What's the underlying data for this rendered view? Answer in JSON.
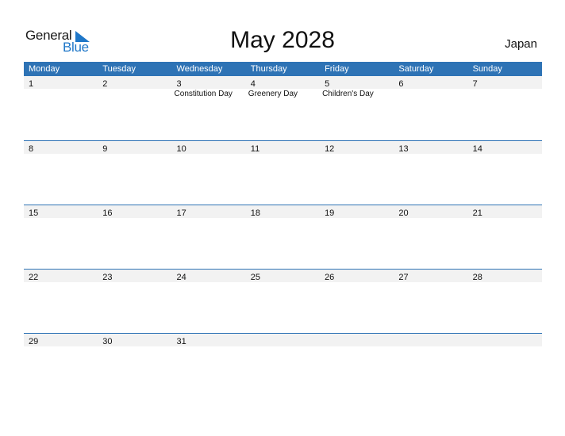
{
  "logo": {
    "word1": "General",
    "word2": "Blue"
  },
  "title": "May 2028",
  "country": "Japan",
  "colors": {
    "accent": "#2e73b5",
    "band": "#f2f2f2",
    "logo_blue": "#1f77c8"
  },
  "weekdays": [
    "Monday",
    "Tuesday",
    "Wednesday",
    "Thursday",
    "Friday",
    "Saturday",
    "Sunday"
  ],
  "weeks": [
    {
      "days": [
        "1",
        "2",
        "3",
        "4",
        "5",
        "6",
        "7"
      ],
      "holidays": [
        "",
        "",
        "Constitution Day",
        "Greenery Day",
        "Children's Day",
        "",
        ""
      ]
    },
    {
      "days": [
        "8",
        "9",
        "10",
        "11",
        "12",
        "13",
        "14"
      ],
      "holidays": [
        "",
        "",
        "",
        "",
        "",
        "",
        ""
      ]
    },
    {
      "days": [
        "15",
        "16",
        "17",
        "18",
        "19",
        "20",
        "21"
      ],
      "holidays": [
        "",
        "",
        "",
        "",
        "",
        "",
        ""
      ]
    },
    {
      "days": [
        "22",
        "23",
        "24",
        "25",
        "26",
        "27",
        "28"
      ],
      "holidays": [
        "",
        "",
        "",
        "",
        "",
        "",
        ""
      ]
    },
    {
      "days": [
        "29",
        "30",
        "31",
        "",
        "",
        "",
        ""
      ],
      "holidays": [
        "",
        "",
        "",
        "",
        "",
        "",
        ""
      ]
    }
  ]
}
